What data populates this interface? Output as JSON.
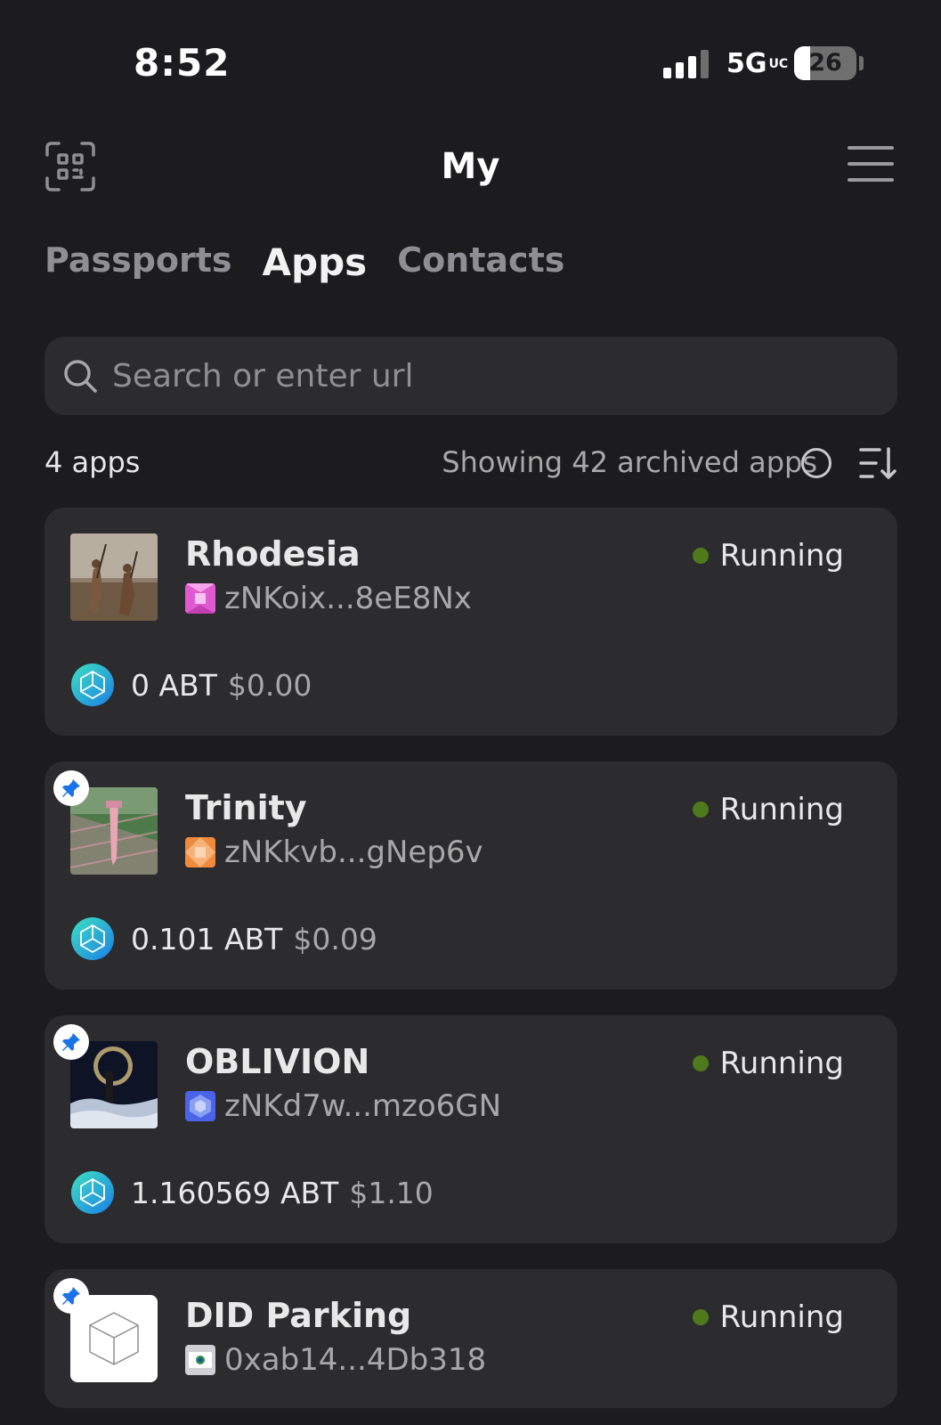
{
  "status_bar": {
    "time": "8:52",
    "network": "5G",
    "network_badge": "UC",
    "battery": "26",
    "battery_level": 0.26
  },
  "header": {
    "title": "My",
    "scan_icon": "qr-scan-icon",
    "menu_icon": "hamburger-menu-icon"
  },
  "tabs": [
    {
      "label": "Passports",
      "active": false
    },
    {
      "label": "Apps",
      "active": true
    },
    {
      "label": "Contacts",
      "active": false
    }
  ],
  "search": {
    "placeholder": "Search or enter url",
    "value": ""
  },
  "summary": {
    "count": "4 apps",
    "archived": "Showing 42 archived apps",
    "archived_toggle": false
  },
  "apps": [
    {
      "name": "Rhodesia",
      "did": "zNKoix...8eE8Nx",
      "status": "Running",
      "pinned": false,
      "amount": "0 ABT",
      "usd": "$0.00",
      "did_color": "#e05ad0"
    },
    {
      "name": "Trinity",
      "did": "zNKkvb...gNep6v",
      "status": "Running",
      "pinned": true,
      "amount": "0.101 ABT",
      "usd": "$0.09",
      "did_color": "#f08a3c"
    },
    {
      "name": "OBLIVION",
      "did": "zNKd7w...mzo6GN",
      "status": "Running",
      "pinned": true,
      "amount": "1.160569 ABT",
      "usd": "$1.10",
      "did_color": "#4b63e8"
    },
    {
      "name": "DID Parking",
      "did": "0xab14...4Db318",
      "status": "Running",
      "pinned": true
    }
  ],
  "colors": {
    "background": "#1c1c1e",
    "card": "#2c2c2e",
    "running_dot": "#4f7a1b",
    "pin": "#1a73e8"
  }
}
